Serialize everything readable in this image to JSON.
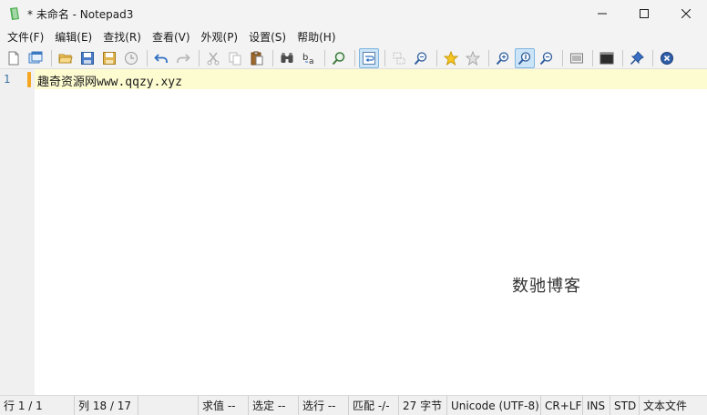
{
  "window": {
    "title": "* 未命名 - Notepad3",
    "minimize_icon": "minimize-icon",
    "maximize_icon": "maximize-icon",
    "close_icon": "close-icon"
  },
  "menu": [
    "文件(F)",
    "编辑(E)",
    "查找(R)",
    "查看(V)",
    "外观(P)",
    "设置(S)",
    "帮助(H)"
  ],
  "editor": {
    "line_number": "1",
    "line_text": "趣奇资源网www.qqzy.xyz",
    "watermark": "数驰博客"
  },
  "status": {
    "line": "行  1 / 1",
    "column": "列   18 / 17",
    "blank": "",
    "sum": "求值  --",
    "selection": "选定  --",
    "selected_lines": "选行  --",
    "match": "匹配  -/-",
    "bytes": "27 字节",
    "encoding": "Unicode (UTF-8)",
    "eol": "CR+LF",
    "ins": "INS",
    "std": "STD",
    "lexer": "文本文件"
  },
  "colors": {
    "current_line": "#fdfbd0",
    "gutter": "#f0f0f0",
    "line_number": "#3a6ea5",
    "caret_marker": "#f5a623",
    "chrome": "#f3f3f3"
  }
}
